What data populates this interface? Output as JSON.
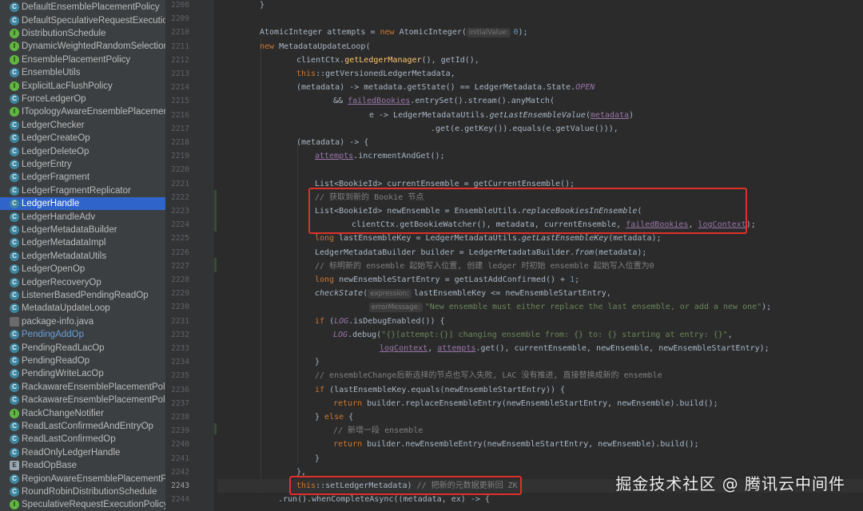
{
  "colors": {
    "sidebar_bg": "#3c3f41",
    "editor_bg": "#2b2b2b",
    "selection": "#2f65ca",
    "highlight_box": "#e0302a"
  },
  "project_tree": {
    "items": [
      {
        "label": "DefaultEnsemblePlacementPolicy",
        "icon": "class-icon"
      },
      {
        "label": "DefaultSpeculativeRequestExecution",
        "icon": "class-icon"
      },
      {
        "label": "DistributionSchedule",
        "icon": "interface-icon"
      },
      {
        "label": "DynamicWeightedRandomSelection",
        "icon": "interface-icon"
      },
      {
        "label": "EnsemblePlacementPolicy",
        "icon": "interface-icon"
      },
      {
        "label": "EnsembleUtils",
        "icon": "class-icon"
      },
      {
        "label": "ExplicitLacFlushPolicy",
        "icon": "interface-icon"
      },
      {
        "label": "ForceLedgerOp",
        "icon": "class-icon"
      },
      {
        "label": "ITopologyAwareEnsemblePlacement",
        "icon": "interface-icon"
      },
      {
        "label": "LedgerChecker",
        "icon": "class-icon"
      },
      {
        "label": "LedgerCreateOp",
        "icon": "class-icon"
      },
      {
        "label": "LedgerDeleteOp",
        "icon": "class-icon"
      },
      {
        "label": "LedgerEntry",
        "icon": "class-icon"
      },
      {
        "label": "LedgerFragment",
        "icon": "class-icon"
      },
      {
        "label": "LedgerFragmentReplicator",
        "icon": "class-icon"
      },
      {
        "label": "LedgerHandle",
        "icon": "class-icon",
        "selected": true
      },
      {
        "label": "LedgerHandleAdv",
        "icon": "class-icon"
      },
      {
        "label": "LedgerMetadataBuilder",
        "icon": "class-icon"
      },
      {
        "label": "LedgerMetadataImpl",
        "icon": "class-icon"
      },
      {
        "label": "LedgerMetadataUtils",
        "icon": "class-icon"
      },
      {
        "label": "LedgerOpenOp",
        "icon": "class-icon"
      },
      {
        "label": "LedgerRecoveryOp",
        "icon": "class-icon"
      },
      {
        "label": "ListenerBasedPendingReadOp",
        "icon": "class-icon"
      },
      {
        "label": "MetadataUpdateLoop",
        "icon": "class-icon"
      },
      {
        "label": "package-info.java",
        "icon": "file-icon"
      },
      {
        "label": "PendingAddOp",
        "icon": "class-icon",
        "modified": true
      },
      {
        "label": "PendingReadLacOp",
        "icon": "class-icon"
      },
      {
        "label": "PendingReadOp",
        "icon": "class-icon"
      },
      {
        "label": "PendingWriteLacOp",
        "icon": "class-icon"
      },
      {
        "label": "RackawareEnsemblePlacementPolicy",
        "icon": "class-icon"
      },
      {
        "label": "RackawareEnsemblePlacementPolicy",
        "icon": "class-icon"
      },
      {
        "label": "RackChangeNotifier",
        "icon": "interface-icon"
      },
      {
        "label": "ReadLastConfirmedAndEntryOp",
        "icon": "class-icon"
      },
      {
        "label": "ReadLastConfirmedOp",
        "icon": "class-icon"
      },
      {
        "label": "ReadOnlyLedgerHandle",
        "icon": "class-icon"
      },
      {
        "label": "ReadOpBase",
        "icon": "enum-icon"
      },
      {
        "label": "RegionAwareEnsemblePlacementPol",
        "icon": "class-icon"
      },
      {
        "label": "RoundRobinDistributionSchedule",
        "icon": "class-icon"
      },
      {
        "label": "SpeculativeRequestExecutionPolicy",
        "icon": "interface-icon"
      }
    ]
  },
  "editor": {
    "line_numbers": [
      "2208",
      "2209",
      "2210",
      "2211",
      "2212",
      "2213",
      "2214",
      "2215",
      "2216",
      "2217",
      "2218",
      "2219",
      "2220",
      "2221",
      "2222",
      "2223",
      "2224",
      "2225",
      "2226",
      "2227",
      "2228",
      "2229",
      "2230",
      "2231",
      "2232",
      "2233",
      "2234",
      "2235",
      "2236",
      "2237",
      "2238",
      "2239",
      "2240",
      "2241",
      "2242",
      "2243",
      "2244"
    ],
    "current_line": "2243",
    "hints": {
      "initial_value": "initialValue:",
      "expression": "expression:",
      "error_message": "errorMessage:"
    },
    "code": {
      "close_brace": "}",
      "atomic_type": "AtomicInteger attempts = ",
      "kw_new": "new",
      "atomic_ctor": " AtomicInteger(",
      "zero": "0",
      "end_paren_semi": ");",
      "loop_ctor": " MetadataUpdateLoop(",
      "client_ctx": "clientCtx.",
      "get_ledger_manager": "getLedgerManager",
      "get_id_part": "(), getId(),",
      "kw_this": "this",
      "versioned": "::getVersionedLedgerMetadata,",
      "lambda_head": "(metadata) -> metadata.getState() == LedgerMetadata.State.",
      "state_open": "OPEN",
      "and_op": "&& ",
      "failed_bookies": "failedBookies",
      "entry_stream": ".entrySet().stream().anyMatch(",
      "lambda_e": "e -> LedgerMetadataUtils.",
      "get_last_ensemble_value": "getLastEnsembleValue",
      "open_paren": "(",
      "metadata_var": "metadata",
      "close_paren": ")",
      "equals_chain": ".get(e.getKey()).equals(e.getValue())),",
      "lambda_block": "(metadata) -> {",
      "attempts_var": "attempts",
      "increment": ".incrementAndGet();",
      "current_ensemble_decl": "List<BookieId> currentEnsemble = getCurrentEnsemble();",
      "comment_get_new": "// 获取到新的 Bookie 节点",
      "new_ensemble_decl": "List<BookieId> newEnsemble = EnsembleUtils.",
      "replace_bookies": "replaceBookiesInEnsemble",
      "watcher_args": "clientCtx.getBookieWatcher(), metadata, currentEnsemble, ",
      "comma_space": ", ",
      "log_context": "logContext",
      "long_kw": "long",
      "last_key_decl": " lastEnsembleKey = LedgerMetadataUtils.",
      "get_last_ensemble_key": "getLastEnsembleKey",
      "metadata_close": "(metadata);",
      "builder_decl": "LedgerMetadataBuilder builder = LedgerMetadataBuilder.",
      "from_fn": "from",
      "comment_mark_start": "// 标明新的 ensemble 起始写入位置, 创建 ledger 时初始 ensemble 起始写入位置为0",
      "start_entry_decl": " newEnsembleStartEntry = getLastAddConfirmed() + ",
      "one": "1",
      "semi": ";",
      "check_state": "checkState",
      "check_expr": "lastEnsembleKey <= newEnsembleStartEntry,",
      "error_msg": "\"New ensemble must either replace the last ensemble, or add a new one\"",
      "kw_if": "if",
      "log_const": "LOG",
      "debug_enabled": ".isDebugEnabled()) {",
      "debug_call": ".debug(",
      "debug_msg": "\"{}[attempt:{}] changing ensemble from: {} to: {} starting at entry: {}\"",
      "comma": ",",
      "attempts_get": ".get(), currentEnsemble, newEnsemble, newEnsembleStartEntry);",
      "comment_change": "// ensembleChange后新选择的节点也写入失败, LAC 没有推进, 直接替换成新的 ensemble",
      "if_equals": " (lastEnsembleKey.equals(newEnsembleStartEntry)) {",
      "kw_return": "return",
      "replace_entry": " builder.replaceEnsembleEntry(newEnsembleStartEntry, newEnsemble).build();",
      "else_open": "} ",
      "kw_else": "else",
      "brace_open": " {",
      "comment_add": "// 新增一段 ensemble",
      "new_entry": " builder.newEnsembleEntry(newEnsembleStartEntry, newEnsemble).build();",
      "close_brace_comma": "},",
      "set_metadata": "::setLedgerMetadata)",
      "comment_update_zk": "// 把新的元数据更新回 ZK",
      "run_async": ".run().whenCompleteAsync((metadata, ex) -> {"
    }
  },
  "watermark": {
    "text": "掘金技术社区 @ 腾讯云中间件"
  }
}
